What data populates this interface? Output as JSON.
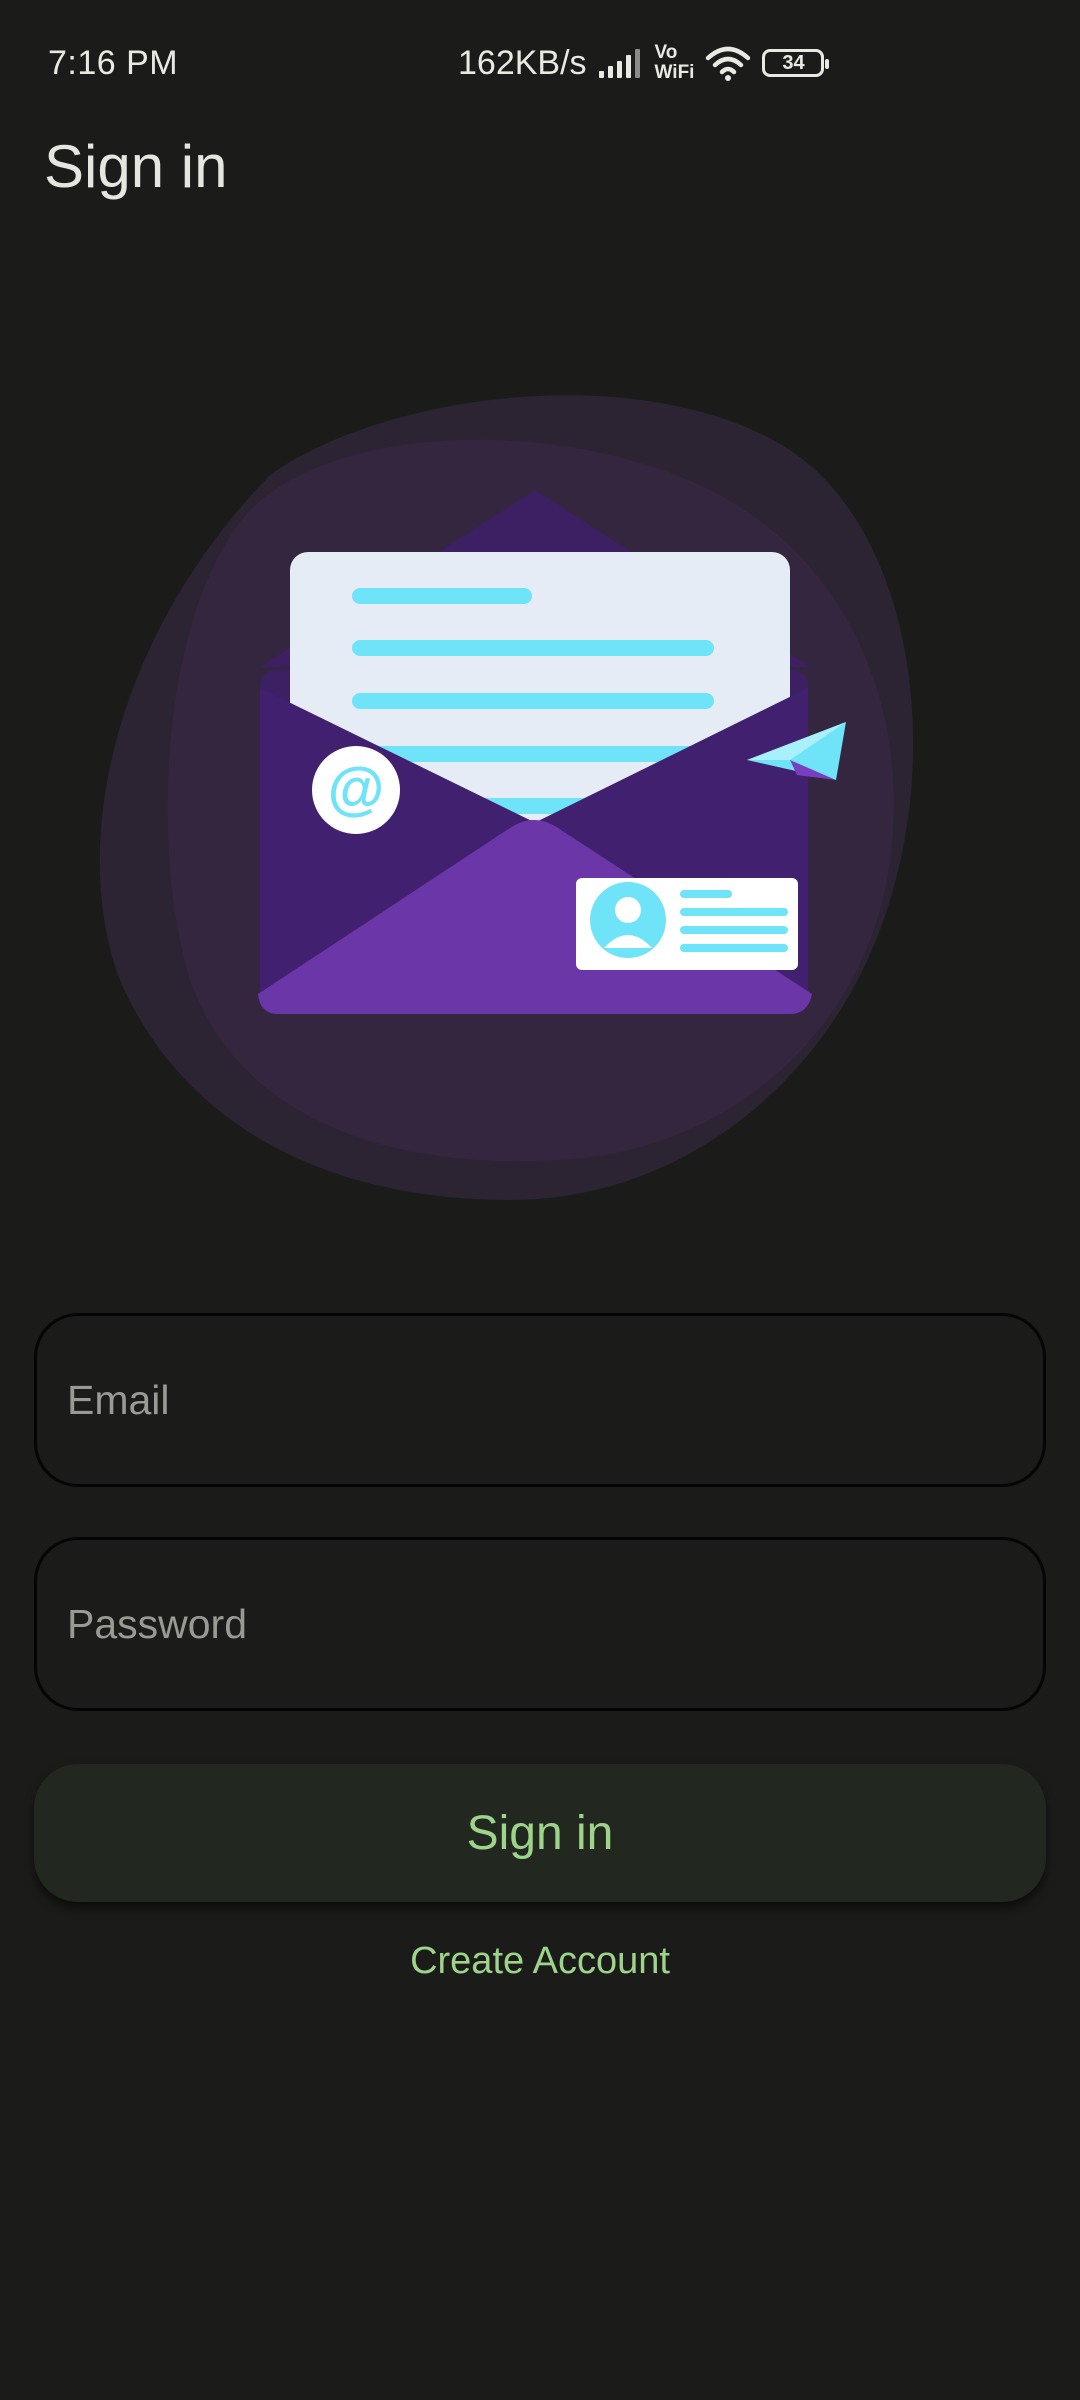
{
  "status_bar": {
    "time": "7:16 PM",
    "net_speed": "162KB/s",
    "vowifi_top": "Vo",
    "vowifi_bottom": "WiFi",
    "battery_level": "34",
    "icons": [
      "signal-icon",
      "vowifi-icon",
      "wifi-icon",
      "battery-icon"
    ]
  },
  "header": {
    "title": "Sign in"
  },
  "illustration": {
    "icons": [
      "envelope-icon",
      "at-sign-icon",
      "paper-plane-icon",
      "contact-card-icon"
    ],
    "colors": {
      "blob_outer": "#2c2333",
      "blob_inner": "#352640",
      "envelope_back": "#3d1f64",
      "envelope_front": "#6b36a8",
      "letter": "#e6ecf5",
      "accent": "#6fe3f7"
    }
  },
  "form": {
    "email_placeholder": "Email",
    "email_value": "",
    "password_placeholder": "Password",
    "password_value": "",
    "signin_label": "Sign in",
    "create_account_label": "Create Account"
  },
  "colors": {
    "background": "#1b1c19",
    "accent_green": "#9ed48a",
    "button_bg": "#222720"
  }
}
